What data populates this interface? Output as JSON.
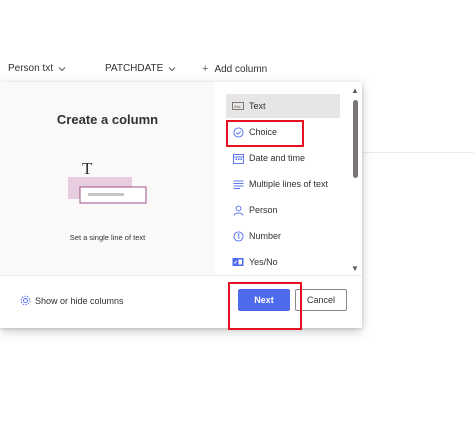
{
  "columns": [
    {
      "label": "Person txt"
    },
    {
      "label": "PATCHDATE"
    },
    {
      "label": "Add column"
    }
  ],
  "dialog": {
    "title": "Create a column",
    "illustration_glyph": "T",
    "caption": "Set a single line of text",
    "column_types": [
      {
        "label": "Text",
        "icon": "text-field-icon",
        "selected": true
      },
      {
        "label": "Choice",
        "icon": "choice-check-icon",
        "selected": false
      },
      {
        "label": "Date and time",
        "icon": "calendar-icon",
        "selected": false
      },
      {
        "label": "Multiple lines of text",
        "icon": "multiline-text-icon",
        "selected": false
      },
      {
        "label": "Person",
        "icon": "person-icon",
        "selected": false
      },
      {
        "label": "Number",
        "icon": "number-icon",
        "selected": false
      },
      {
        "label": "Yes/No",
        "icon": "yes-no-toggle-icon",
        "selected": false
      }
    ],
    "footer": {
      "show_hide_label": "Show or hide columns",
      "next_label": "Next",
      "cancel_label": "Cancel"
    }
  },
  "colors": {
    "accent": "#4f6bed",
    "highlight": "#e81123",
    "selected_row": "#e8e6e4",
    "illustration_pink": "#e6cde0",
    "illustration_border": "#a0508c"
  }
}
